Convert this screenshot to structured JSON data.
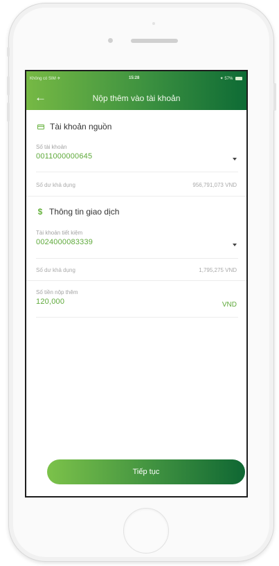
{
  "status_bar": {
    "carrier": "Không có SIM ✈",
    "time": "15:28",
    "battery": "✦ 57%"
  },
  "header": {
    "title": "Nộp thêm vào tài khoản",
    "back_icon": "←"
  },
  "source_section": {
    "title": "Tài khoản nguồn",
    "account_label": "Số tài khoản",
    "account_value": "0011000000645",
    "available_label": "Số dư khả dụng",
    "available_value": "956,791,073 VND"
  },
  "transaction_section": {
    "title": "Thông tin giao dịch",
    "savings_label": "Tài khoản tiết kiệm",
    "savings_value": "0024000083339",
    "available_label": "Số dư khả dụng",
    "available_value": "1,795,275 VND",
    "amount_label": "Số tiền nộp thêm",
    "amount_value": "120,000",
    "currency": "VND"
  },
  "continue_button": {
    "label": "Tiếp tục"
  },
  "colors": {
    "accent_green": "#5ea93a",
    "header_start": "#76b944",
    "header_end": "#0e6b35"
  },
  "icons": {
    "back": "arrow-left-icon",
    "card": "card-icon",
    "dollar": "dollar-icon",
    "dropdown": "chevron-down-icon"
  }
}
